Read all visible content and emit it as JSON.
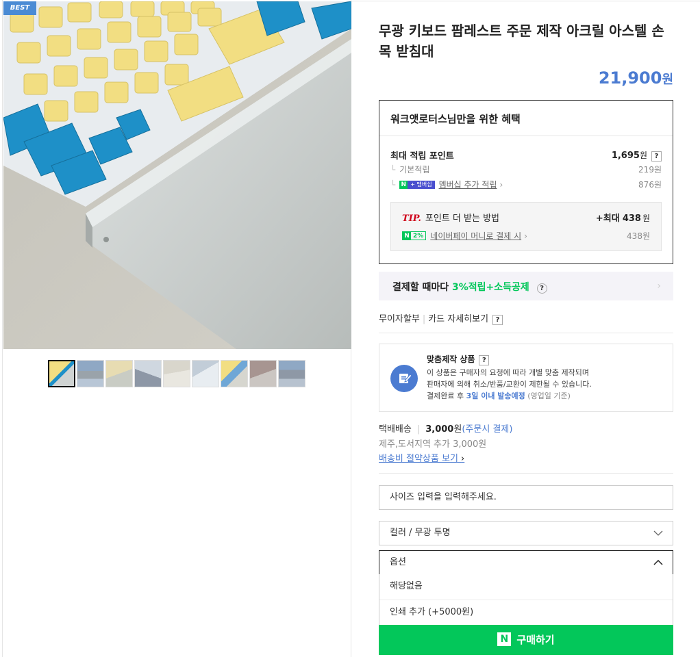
{
  "gallery": {
    "badge": "BEST",
    "thumb_count": 9
  },
  "product": {
    "title": "무광 키보드 팜레스트 주문 제작 아크릴 아스텔 손목 받침대",
    "price": "21,900",
    "price_unit": "원"
  },
  "benefit": {
    "title": "워크앳로터스님만을 위한 혜택",
    "max_points_label": "최대 적립 포인트",
    "max_points_value": "1,695",
    "max_points_unit": "원",
    "base_label": "기본적립",
    "base_value": "219원",
    "member_badge_n": "N",
    "member_badge_label": "+ 멤버십",
    "member_label": "멤버십 추가 적립",
    "member_value": "876원",
    "tip_word": "TIP.",
    "tip_label": "포인트 더 받는 방법",
    "tip_max_prefix": "+최대",
    "tip_max_value": "438",
    "tip_max_unit": "원",
    "npay_chip_n": "N",
    "npay_chip_pct": "2%",
    "npay_label": "네이버페이 머니로 결제 시",
    "npay_value": "438원"
  },
  "card_banner": {
    "prefix": "결제할 때마다",
    "highlight": "3%적립+소득공제"
  },
  "install": {
    "label1": "무이자할부",
    "label2": "카드 자세히보기"
  },
  "custom": {
    "title": "맞춤제작 상품",
    "line1": "이 상품은 구매자의 요청에 따라 개별 맞춤 제작되며",
    "line2": "판매자에 의해 취소/반품/교환이 제한될 수 있습니다.",
    "line3_prefix": "결제완료 후",
    "line3_blue": "3일 이내 발송예정",
    "line3_suffix": "(영업일 기준)"
  },
  "shipping": {
    "type": "택배배송",
    "amount": "3,000",
    "unit": "원",
    "note": "(주문시 결제)",
    "extra": "제주,도서지역 추가 3,000원",
    "link": "배송비 절약상품 보기"
  },
  "options": {
    "size_input_placeholder": "사이즈 입력을 입력해주세요.",
    "color_value": "컬러 / 무광 투명",
    "option_value": "옵션",
    "option_items": [
      "해당없음",
      "인쇄 추가 (+5000원)"
    ]
  },
  "buy": {
    "n": "N",
    "label": "구매하기"
  },
  "colors": {
    "accent_blue": "#4b7bd1",
    "naver_green": "#03c75a",
    "tip_red": "#d0021b"
  }
}
